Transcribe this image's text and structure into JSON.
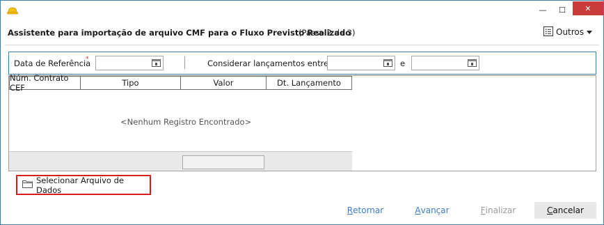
{
  "window": {
    "min_glyph": "—",
    "max_glyph": "☐",
    "close_glyph": "✕",
    "accent": "#3c7fb1",
    "close_color": "#c83c3c"
  },
  "header": {
    "title": "Assistente para importação de arquivo CMF para o Fluxo Previsto Realizado",
    "step": "(Passo 2 de 3)",
    "outros_label": "Outros"
  },
  "filters": {
    "reference_date_label": "Data de Referência",
    "required_mark": "*",
    "reference_date_value": "",
    "range_label": "Considerar lançamentos entre",
    "range_start_value": "",
    "range_and_label": "e",
    "range_end_value": ""
  },
  "grid": {
    "columns": [
      "Núm. Contrato CEF",
      "Tipo",
      "Valor",
      "Dt. Lançamento"
    ],
    "rows": [],
    "empty_message": "<Nenhum Registro Encontrado>"
  },
  "actions": {
    "select_file_label": "Selecionar Arquivo de Dados",
    "highlight_color": "#d41f1f"
  },
  "nav": {
    "back_first": "R",
    "back_rest": "etornar",
    "next_first": "A",
    "next_rest": "vançar",
    "finish_first": "F",
    "finish_rest": "inalizar",
    "cancel_first": "C",
    "cancel_rest": "ancelar"
  }
}
